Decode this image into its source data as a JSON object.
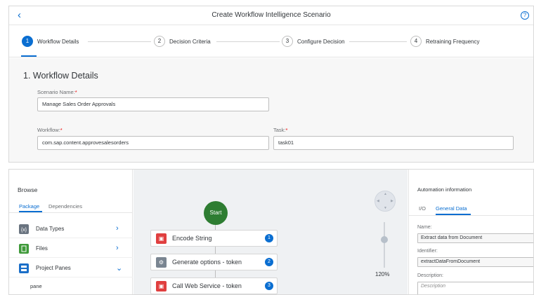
{
  "dialog": {
    "title": "Create Workflow Intelligence Scenario",
    "back_glyph": "‹",
    "help_glyph": "?"
  },
  "steps": [
    {
      "number": "1",
      "label": "Workflow Details"
    },
    {
      "number": "2",
      "label": "Decision Criteria"
    },
    {
      "number": "3",
      "label": "Configure Decision"
    },
    {
      "number": "4",
      "label": "Retraining Frequency"
    }
  ],
  "form": {
    "section_title": "1. Workflow Details",
    "scenario_name_label": "Scenario Name:",
    "scenario_name_value": "Manage Sales Order Approvals",
    "workflow_label": "Workflow:",
    "workflow_value": "com.sap.content.approvesalesorders",
    "task_label": "Task:",
    "task_value": "task01",
    "required_mark": "*"
  },
  "browse": {
    "title": "Browse",
    "tabs": {
      "package": "Package",
      "dependencies": "Dependencies"
    },
    "items": [
      {
        "label": "Data Types",
        "icon": "data-types-icon",
        "chevron": "›"
      },
      {
        "label": "Files",
        "icon": "files-icon",
        "chevron": "›"
      },
      {
        "label": "Project Panes",
        "icon": "project-panes-icon",
        "chevron": "⌄"
      }
    ],
    "sub_item": "pane"
  },
  "canvas": {
    "start_label": "Start",
    "zoom": "120%",
    "nodes": [
      {
        "label": "Encode String",
        "badge": "1",
        "icon_color": "#e03f3f"
      },
      {
        "label": "Generate options - token",
        "badge": "2",
        "icon_color": "#7a8591"
      },
      {
        "label": "Call Web Service - token",
        "badge": "3",
        "icon_color": "#e03f3f"
      }
    ]
  },
  "automation": {
    "title": "Automation information",
    "tabs": {
      "io": "I/O",
      "general": "General Data"
    },
    "name_label": "Name:",
    "name_value": "Extract data from Document",
    "identifier_label": "Identifier:",
    "identifier_value": "extractDataFromDocument",
    "description_label": "Description:",
    "description_placeholder": "Description"
  },
  "colors": {
    "accent": "#0a6ed1",
    "start_green": "#2e7d32",
    "required": "#ee0000"
  }
}
